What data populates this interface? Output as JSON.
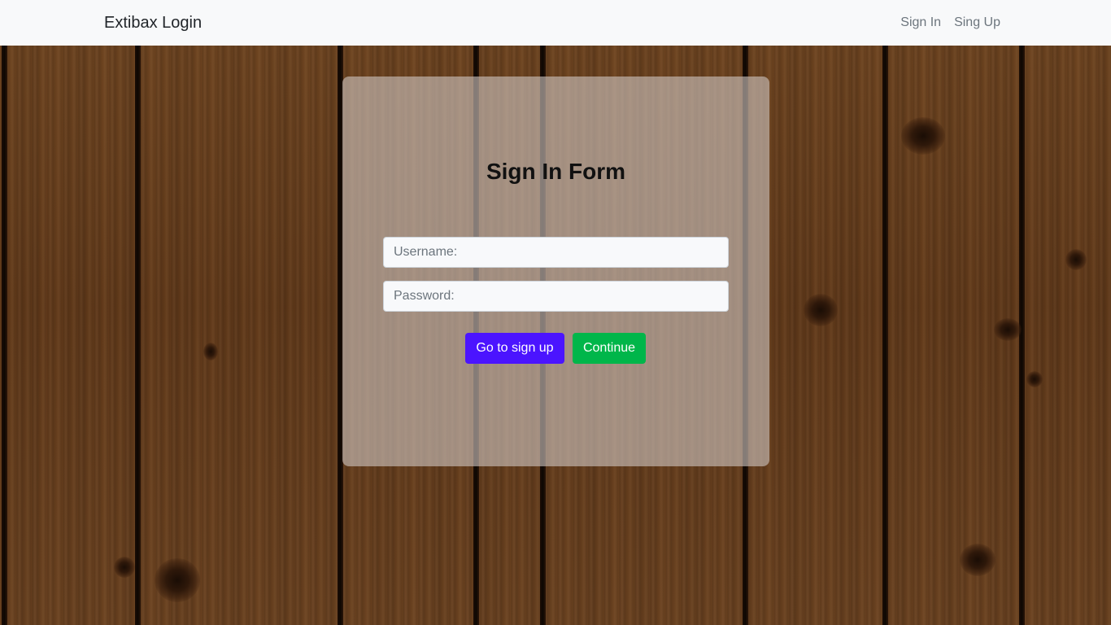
{
  "navbar": {
    "brand": "Extibax Login",
    "links": [
      "Sign In",
      "Sing Up"
    ]
  },
  "form": {
    "title": "Sign In Form",
    "username_placeholder": "Username:",
    "password_placeholder": "Password:",
    "signup_button": "Go to sign up",
    "continue_button": "Continue"
  },
  "colors": {
    "signup_button": "#4b14ff",
    "continue_button": "#00b64a",
    "navbar_bg": "#f8f9fa"
  }
}
